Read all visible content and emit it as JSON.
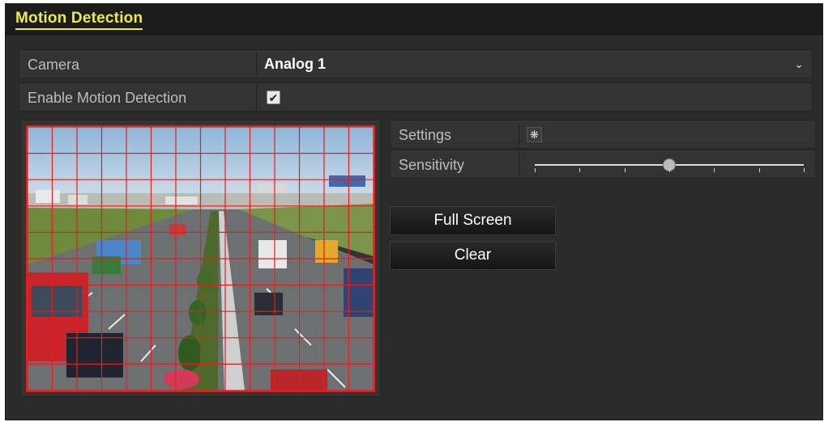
{
  "window": {
    "title": "Motion Detection"
  },
  "camera": {
    "label": "Camera",
    "value": "Analog 1",
    "dropdown_icon": "chevron-down-icon"
  },
  "enable_motion": {
    "label": "Enable Motion Detection",
    "checked": true,
    "icon": "checkmark-icon"
  },
  "settings": {
    "label": "Settings",
    "icon": "gear-icon"
  },
  "sensitivity": {
    "label": "Sensitivity",
    "level_fraction": 0.5,
    "tick_count": 7
  },
  "buttons": {
    "full_screen": "Full Screen",
    "clear": "Clear"
  },
  "preview": {
    "description_icon": "camera-preview",
    "grid": {
      "columns": 14,
      "rows": 10
    }
  },
  "colors": {
    "title": "#f0e94a",
    "grid": "#e02020",
    "panel": "#2b2b2b"
  }
}
